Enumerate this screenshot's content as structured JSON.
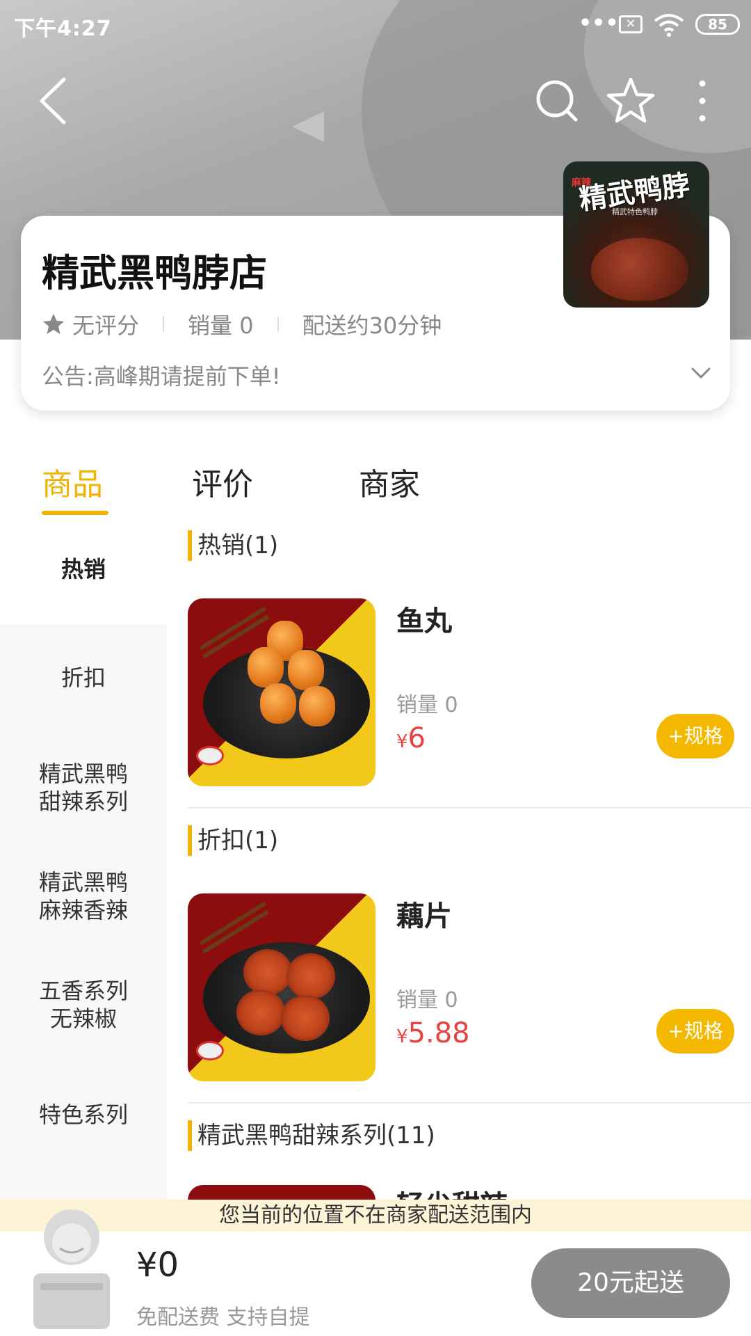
{
  "status_bar": {
    "time": "下午4:27",
    "battery": "85"
  },
  "store": {
    "name": "精武黑鸭脖店",
    "rating": "无评分",
    "sales": "销量 0",
    "delivery_time": "配送约30分钟",
    "notice": "公告:高峰期请提前下单!",
    "logo_text": {
      "title": "精武鸭脖",
      "tag": "麻辣",
      "sub": "精武特色鸭脖"
    }
  },
  "tabs": [
    {
      "label": "商品",
      "active": true
    },
    {
      "label": "评价",
      "active": false
    },
    {
      "label": "商家",
      "active": false
    }
  ],
  "sidebar": {
    "items": [
      {
        "label": "热销",
        "active": true
      },
      {
        "label": "折扣",
        "active": false
      },
      {
        "label": "精武黑鸭\n甜辣系列",
        "active": false
      },
      {
        "label": "精武黑鸭\n麻辣香辣",
        "active": false
      },
      {
        "label": "五香系列\n无辣椒",
        "active": false
      },
      {
        "label": "特色系列",
        "active": false
      }
    ]
  },
  "sections": [
    {
      "title": "热销(1)",
      "products": [
        {
          "name": "鱼丸",
          "sales": "销量 0",
          "currency": "¥",
          "price": "6",
          "button": "+规格"
        }
      ]
    },
    {
      "title": "折扣(1)",
      "products": [
        {
          "name": "藕片",
          "sales": "销量 0",
          "currency": "¥",
          "price": "5.88",
          "button": "+规格"
        }
      ]
    },
    {
      "title": "精武黑鸭甜辣系列(11)",
      "products": [
        {
          "name": "轻尖甜辣"
        }
      ]
    }
  ],
  "warning": "您当前的位置不在商家配送范围内",
  "cart": {
    "total": "¥0",
    "note": "免配送费  支持自提",
    "checkout_label": "20元起送"
  },
  "colors": {
    "accent": "#f2b400",
    "price": "#e64340",
    "checkout_disabled": "#8b8b8b",
    "warning_bg": "#fdf4d8"
  }
}
